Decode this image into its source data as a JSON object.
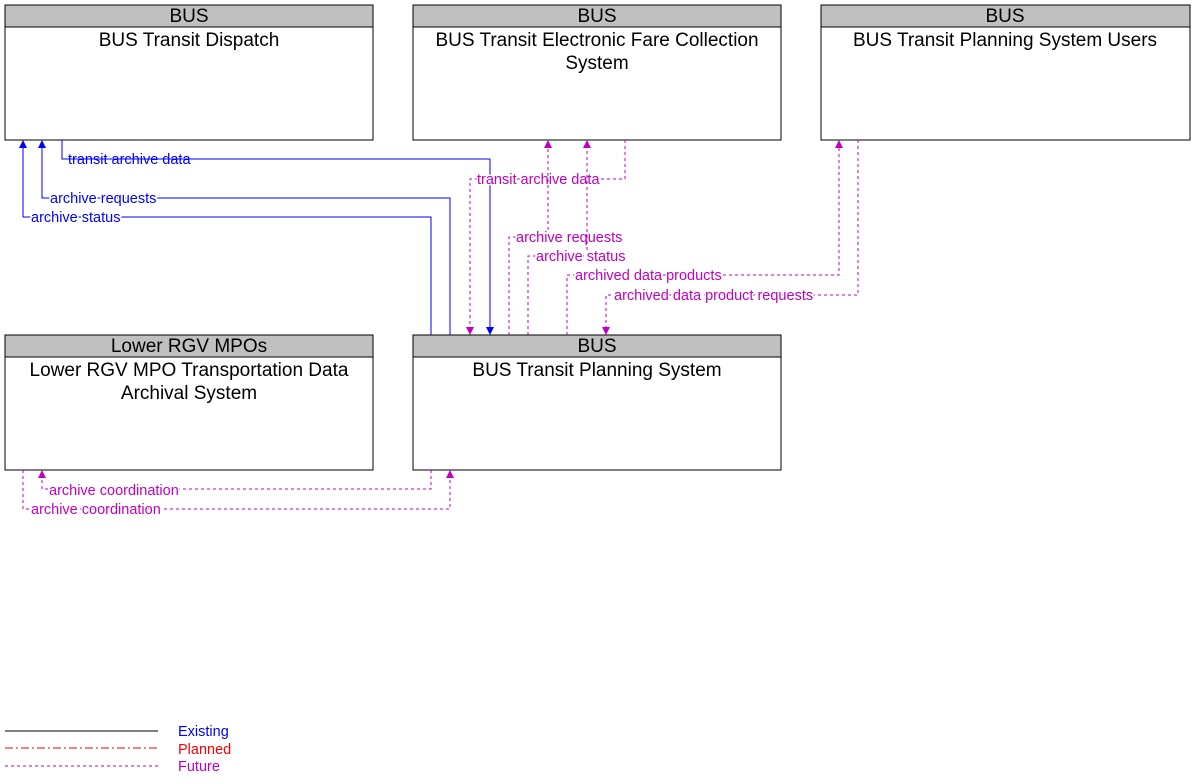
{
  "elements": [
    {
      "owner": "BUS",
      "name": "BUS Transit Dispatch",
      "name2": ""
    },
    {
      "owner": "BUS",
      "name": "BUS Transit Electronic Fare Collection",
      "name2": "System"
    },
    {
      "owner": "BUS",
      "name": "BUS Transit Planning System Users",
      "name2": ""
    },
    {
      "owner": "Lower RGV MPOs",
      "name": "Lower RGV MPO Transportation Data",
      "name2": "Archival System"
    },
    {
      "owner": "BUS",
      "name": "BUS Transit Planning System",
      "name2": ""
    }
  ],
  "flows": [
    {
      "label": "transit archive data",
      "status": "Existing"
    },
    {
      "label": "archive requests",
      "status": "Existing"
    },
    {
      "label": "archive status",
      "status": "Existing"
    },
    {
      "label": "transit archive data",
      "status": "Future"
    },
    {
      "label": "archive requests",
      "status": "Future"
    },
    {
      "label": "archive status",
      "status": "Future"
    },
    {
      "label": "archived data products",
      "status": "Future"
    },
    {
      "label": "archived data product requests",
      "status": "Future"
    },
    {
      "label": "archive coordination",
      "status": "Future"
    },
    {
      "label": "archive coordination",
      "status": "Future"
    }
  ],
  "legend": {
    "existing": "Existing",
    "planned": "Planned",
    "future": "Future"
  },
  "colors": {
    "existing": "#0000ff",
    "planned": "#ff0000",
    "future": "#c000c0",
    "header": "#c0c0c0"
  }
}
